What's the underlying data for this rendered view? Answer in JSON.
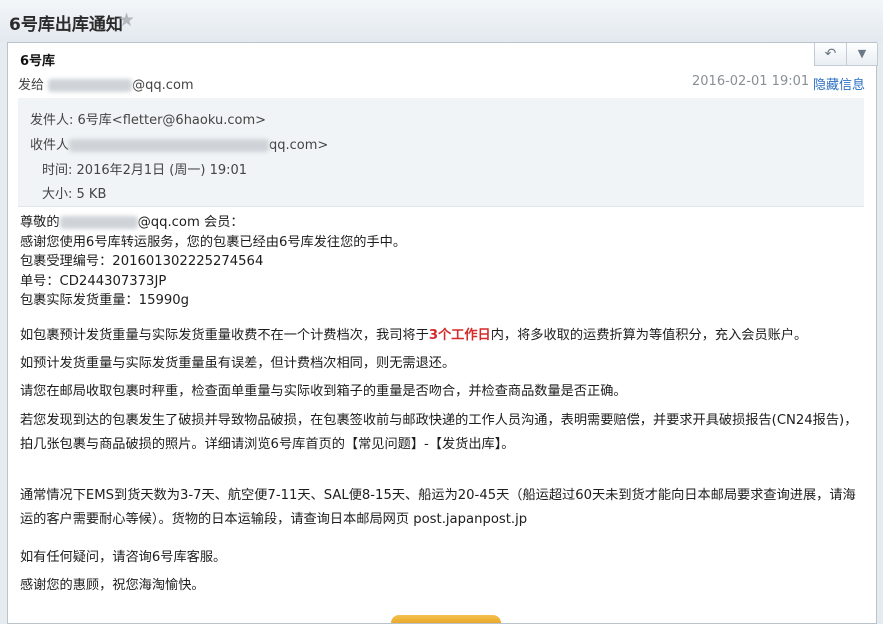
{
  "window": {
    "title": "6号库出库通知",
    "star_icon": "star-icon"
  },
  "header": {
    "sender_name": "6号库",
    "sendto_label": "发给",
    "sendto_suffix": "@qq.com",
    "date": "2016-02-01 19:01",
    "hide_info_label": "隐藏信息",
    "reply_icon": "reply-icon",
    "more_icon": "chevron-down-icon"
  },
  "details": {
    "from_label": "发件人:",
    "from_value": "6号库<fletter@6haoku.com>",
    "to_label": "收件人",
    "to_suffix": "qq.com>",
    "time_label": "时间:",
    "time_value": "2016年2月1日 (周一) 19:01",
    "size_label": "大小:",
    "size_value": "5 KB"
  },
  "body": {
    "greeting_prefix": "尊敬的",
    "greeting_suffix": "@qq.com 会员：",
    "line_thanks": "感谢您使用6号库转运服务，您的包裹已经由6号库发往您的手中。",
    "line_order": "包裹受理编号：201601302225274564",
    "line_tracking": "单号：CD244307373JP",
    "line_weight": "包裹实际发货重量：15990g",
    "para1_pre": "如包裹预计发货重量与实际发货重量收费不在一个计费档次，我司将于",
    "para1_highlight": "3个工作日",
    "para1_post": "内，将多收取的运费折算为等值积分，充入会员账户。",
    "para2": "如预计发货重量与实际发货重量虽有误差，但计费档次相同，则无需退还。",
    "para3": "请您在邮局收取包裹时秤重，检查面单重量与实际收到箱子的重量是否吻合，并检查商品数量是否正确。",
    "para4": "若您发现到达的包裹发生了破损并导致物品破损，在包裹签收前与邮政快递的工作人员沟通，表明需要赔偿，并要求开具破损报告(CN24报告)，拍几张包裹与商品破损的照片。详细请浏览6号库首页的【常见问题】-【发货出库】。",
    "para5": "通常情况下EMS到货天数为3-7天、航空便7-11天、SAL便8-15天、船运为20-45天（船运超过60天未到货才能向日本邮局要求查询进展，请海运的客户需要耐心等候）。货物的日本运输段，请查询日本邮局网页 post.japanpost.jp",
    "para6": "如有任何疑问，请咨询6号库客服。",
    "para7": "感谢您的惠顾，祝您海淘愉快。"
  }
}
